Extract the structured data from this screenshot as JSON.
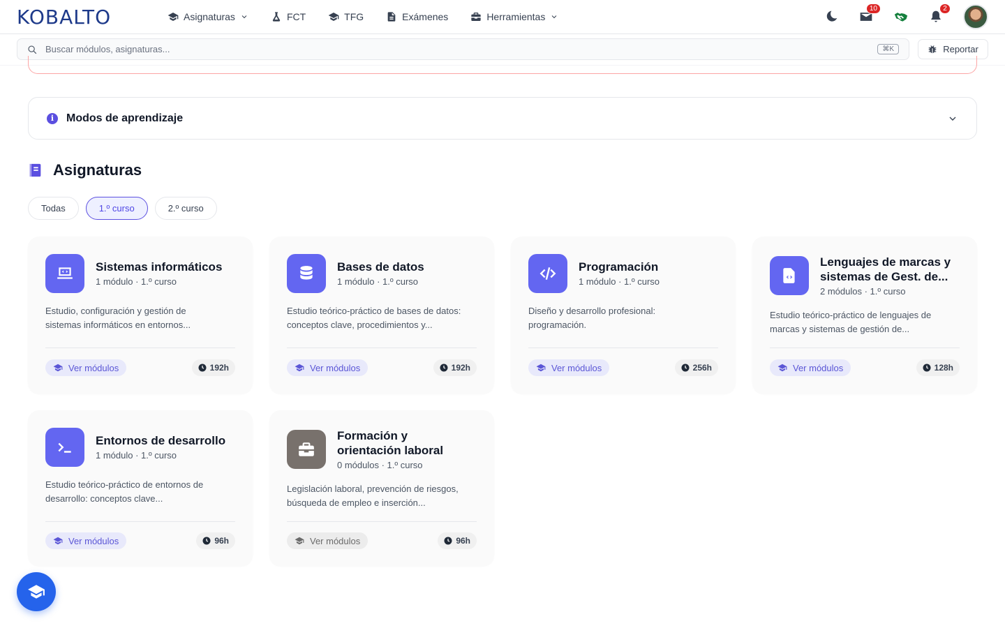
{
  "brand": {
    "logo": "KOBALTO"
  },
  "nav": [
    {
      "label": "Asignaturas",
      "icon": "graduation-cap-icon",
      "dropdown": true
    },
    {
      "label": "FCT",
      "icon": "flask-icon",
      "dropdown": false
    },
    {
      "label": "TFG",
      "icon": "graduation-cap-icon",
      "dropdown": false
    },
    {
      "label": "Exámenes",
      "icon": "document-icon",
      "dropdown": false
    },
    {
      "label": "Herramientas",
      "icon": "toolbox-icon",
      "dropdown": true
    }
  ],
  "header_right": {
    "theme_icon": "moon-icon",
    "messages_badge": "10",
    "handshake_icon": "handshake-icon",
    "notifications_badge": "2",
    "avatar": "user-avatar"
  },
  "search": {
    "placeholder": "Buscar módulos, asignaturas...",
    "shortcut": "⌘K"
  },
  "report_button": {
    "label": "Reportar",
    "icon": "bug-icon"
  },
  "accordion": {
    "title": "Modos de aprendizaje",
    "icon": "info-icon"
  },
  "section": {
    "title": "Asignaturas",
    "icon": "book-icon"
  },
  "filters": [
    {
      "label": "Todas",
      "active": false
    },
    {
      "label": "1.º curso",
      "active": true
    },
    {
      "label": "2.º curso",
      "active": false
    }
  ],
  "cards": [
    {
      "title": "Sistemas informáticos",
      "meta": "1 módulo · 1.º curso",
      "description_lines": [
        "Estudio, configuración y gestión de",
        "sistemas informáticos en entornos..."
      ],
      "button": "Ver módulos",
      "hours": "192h",
      "icon": "laptop-code-icon",
      "color": "#6366f1"
    },
    {
      "title": "Bases de datos",
      "meta": "1 módulo · 1.º curso",
      "description_lines": [
        "Estudio teórico-práctico de bases de datos:",
        "conceptos clave, procedimientos y..."
      ],
      "button": "Ver módulos",
      "hours": "192h",
      "icon": "database-icon",
      "color": "#6366f1"
    },
    {
      "title": "Programación",
      "meta": "1 módulo · 1.º curso",
      "description_lines": [
        "Diseño y desarrollo profesional:",
        "programación."
      ],
      "button": "Ver módulos",
      "hours": "256h",
      "icon": "code-icon",
      "color": "#6366f1"
    },
    {
      "title_lines": [
        "Lenguajes de marcas y",
        "sistemas de Gest. de..."
      ],
      "meta": "2 módulos · 1.º curso",
      "description_lines": [
        "Estudio teórico-práctico de lenguajes de",
        "marcas y sistemas de gestión de..."
      ],
      "button": "Ver módulos",
      "hours": "128h",
      "icon": "file-code-icon",
      "color": "#6366f1"
    },
    {
      "title": "Entornos de desarrollo",
      "meta": "1 módulo · 1.º curso",
      "description_lines": [
        "Estudio teórico-práctico de entornos de",
        "desarrollo: conceptos clave..."
      ],
      "button": "Ver módulos",
      "hours": "96h",
      "icon": "terminal-icon",
      "color": "#6366f1"
    },
    {
      "title_lines": [
        "Formación y",
        "orientación laboral"
      ],
      "meta": "0 módulos · 1.º curso",
      "description_lines": [
        "Legislación laboral, prevención de riesgos,",
        "búsqueda de empleo e inserción..."
      ],
      "button": "Ver módulos",
      "hours": "96h",
      "icon": "briefcase-icon",
      "color": "#78716c"
    }
  ],
  "fab": {
    "icon": "graduation-cap-icon"
  }
}
